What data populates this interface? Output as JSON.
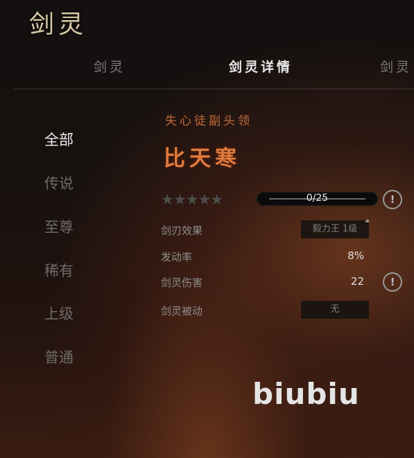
{
  "header": {
    "title": "剑灵"
  },
  "tabs": [
    {
      "label": "剑灵",
      "active": false
    },
    {
      "label": "剑灵详情",
      "active": true
    },
    {
      "label": "剑灵",
      "active": false
    }
  ],
  "categories": [
    {
      "label": "全部",
      "active": true
    },
    {
      "label": "传说",
      "active": false
    },
    {
      "label": "至尊",
      "active": false
    },
    {
      "label": "稀有",
      "active": false
    },
    {
      "label": "上级",
      "active": false
    },
    {
      "label": "普通",
      "active": false
    }
  ],
  "detail": {
    "subtitle": "失心徒副头领",
    "name": "比天寒",
    "stars": {
      "filled": 0,
      "total": 5,
      "glyph": "★★★★★"
    },
    "progress": {
      "text": "0/25",
      "current": 0,
      "max": 25
    },
    "rows": [
      {
        "label": "剑刃效果",
        "value": "毅力王 1级",
        "style": "pill",
        "locked": true
      },
      {
        "label": "发动率",
        "value": "8%",
        "style": "plain"
      },
      {
        "label": "剑灵伤害",
        "value": "22",
        "style": "plain",
        "info": true
      },
      {
        "label": "剑灵被动",
        "value": "无",
        "style": "pill"
      }
    ],
    "info_glyph": "!"
  },
  "watermark": "biubiu",
  "colors": {
    "accent": "#e07a3c",
    "subtitle": "#c26a3a",
    "muted": "#6e6a67"
  }
}
